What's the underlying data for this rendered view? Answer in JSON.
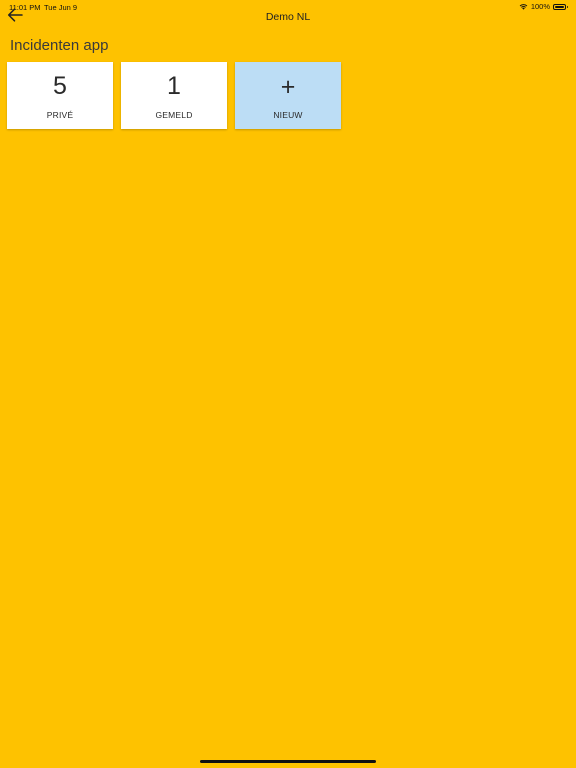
{
  "status_bar": {
    "time": "11:01 PM",
    "date": "Tue Jun 9",
    "battery": "100%",
    "icons": [
      "wifi-icon",
      "battery-icon"
    ]
  },
  "nav": {
    "title": "Demo NL",
    "back_icon": "arrow-left-icon"
  },
  "page": {
    "title": "Incidenten app"
  },
  "tiles": [
    {
      "value": "5",
      "label": "PRIVÉ",
      "background": "#FFFFFF"
    },
    {
      "value": "1",
      "label": "GEMELD",
      "background": "#FFFFFF"
    },
    {
      "value": "+",
      "label": "NIEUW",
      "background": "#BCDDF5",
      "icon": "plus-icon"
    }
  ],
  "colors": {
    "background": "#FEC200",
    "tile": "#FFFFFF",
    "tile_new": "#BCDDF5",
    "text": "#222222"
  }
}
